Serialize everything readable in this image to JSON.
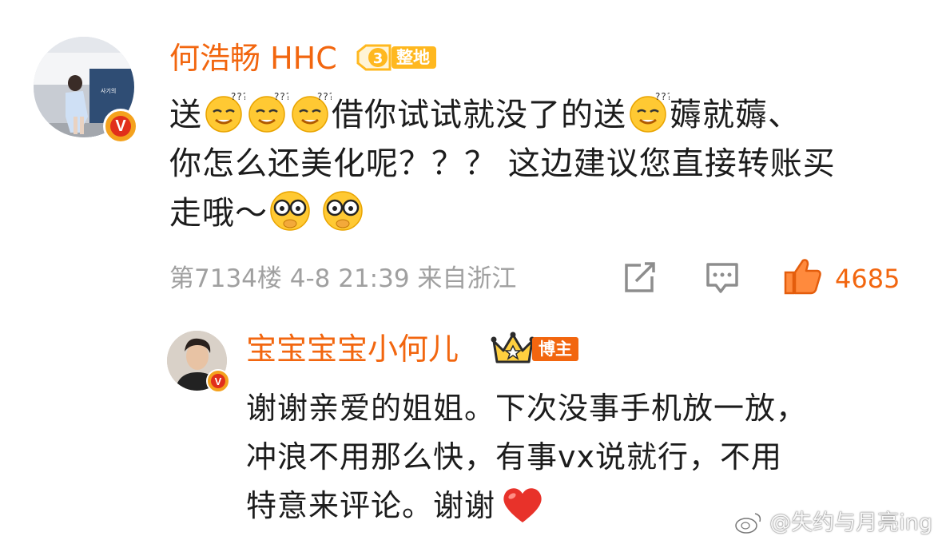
{
  "comment": {
    "username": "何浩畅 HHC",
    "level": "3",
    "location_tag": "整地",
    "line1_a": "送",
    "line1_b": "借你试试就没了的送",
    "line1_c": "薅就薅、",
    "line2": "你怎么还美化呢？？？ 这边建议您直接转账买",
    "line3": "走哦～",
    "meta": "第7134楼 4-8 21:39 来自浙江",
    "like_count": "4685",
    "icons": [
      "share-icon",
      "comment-icon",
      "like-icon"
    ]
  },
  "reply": {
    "username": "宝宝宝宝小何儿",
    "role_tag": "博主",
    "line1": "谢谢亲爱的姐姐。下次没事手机放一放，",
    "line2": "冲浪不用那么快，有事vx说就行，不用",
    "line3": "特意来评论。谢谢",
    "end_emoji": "heart-icon"
  },
  "watermark": "@失约与月亮ing",
  "colors": {
    "accent": "#f2660f",
    "meta_gray": "#a0a0a0",
    "level_yellow": "#ffb81f",
    "verified_red": "#e12f1b"
  }
}
